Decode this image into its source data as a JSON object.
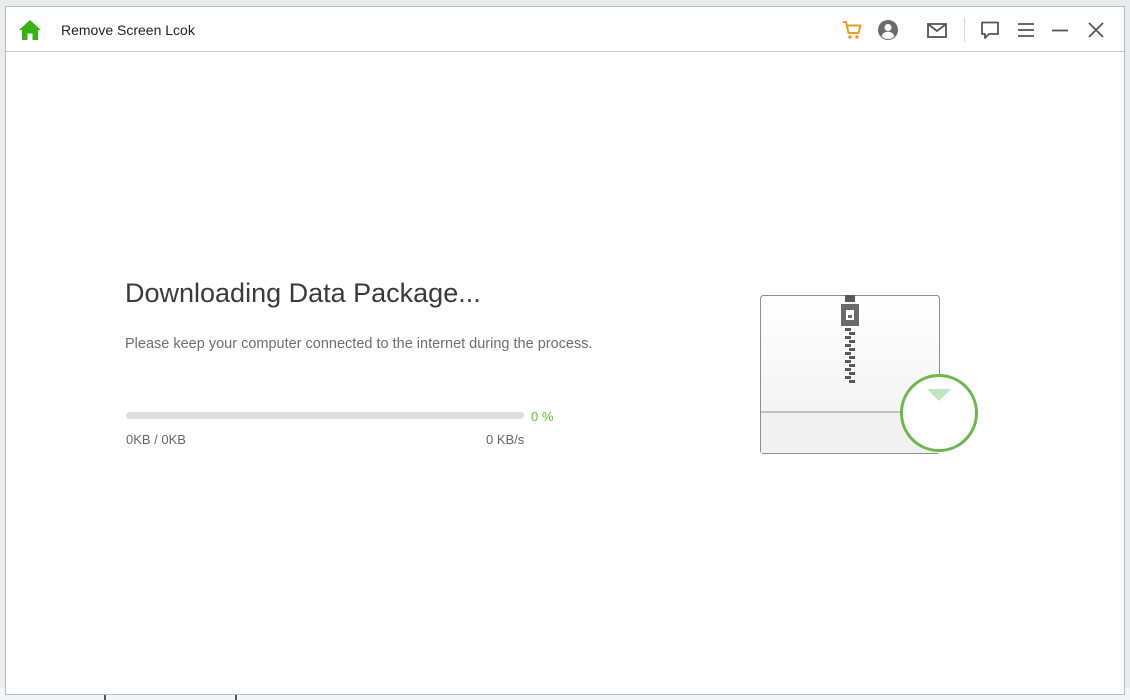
{
  "window": {
    "title": "Remove Screen Lcok"
  },
  "toolbar": {
    "icons": [
      "home-icon",
      "cart-icon",
      "account-icon",
      "mail-icon",
      "feedback-icon",
      "menu-icon",
      "minimize-icon",
      "close-icon"
    ]
  },
  "main": {
    "heading": "Downloading Data Package...",
    "subtext": "Please keep your computer connected to the internet during the process.",
    "progress": {
      "value": 0,
      "percent_label": "0 %",
      "size_label": "0KB / 0KB",
      "speed_label": "0 KB/s"
    }
  },
  "colors": {
    "accent_green": "#5cc12e",
    "cart_orange": "#f39a1e",
    "icon_gray": "#555555",
    "progress_track": "#dedede"
  }
}
